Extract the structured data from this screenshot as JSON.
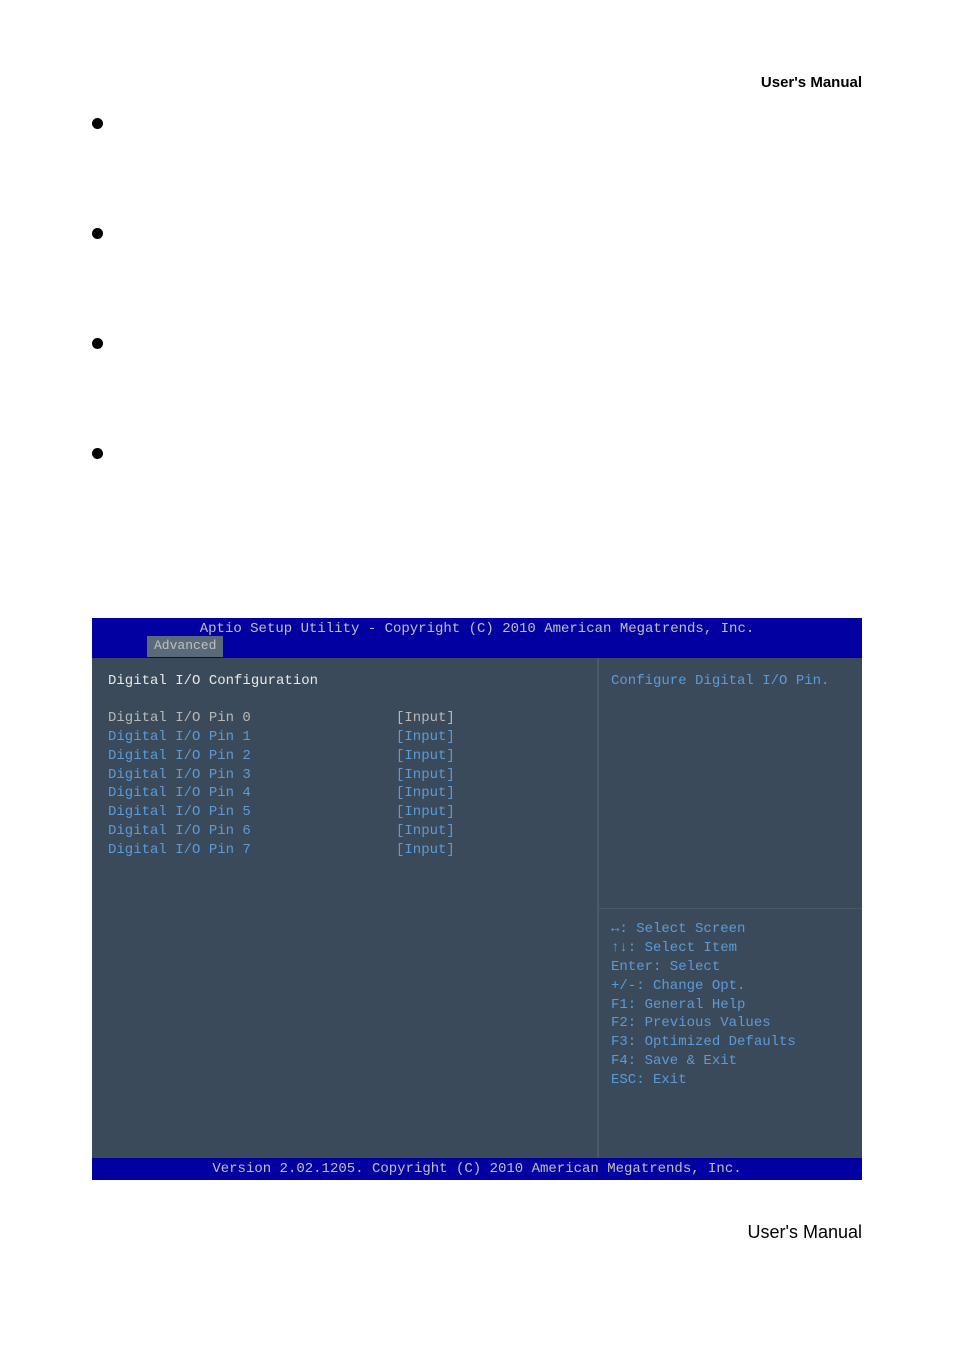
{
  "header": {
    "label": "User's  Manual"
  },
  "footer": {
    "label": "User's  Manual"
  },
  "bios": {
    "title": "Aptio Setup Utility - Copyright (C) 2010 American Megatrends, Inc.",
    "tab": "Advanced",
    "section_head": "Digital I/O Configuration",
    "pins": [
      {
        "label": "Digital I/O Pin 0",
        "value": "[Input]",
        "selected": true
      },
      {
        "label": "Digital I/O Pin 1",
        "value": "[Input]",
        "selected": false
      },
      {
        "label": "Digital I/O Pin 2",
        "value": "[Input]",
        "selected": false
      },
      {
        "label": "Digital I/O Pin 3",
        "value": "[Input]",
        "selected": false
      },
      {
        "label": "Digital I/O Pin 4",
        "value": "[Input]",
        "selected": false
      },
      {
        "label": "Digital I/O Pin 5",
        "value": "[Input]",
        "selected": false
      },
      {
        "label": "Digital I/O Pin 6",
        "value": "[Input]",
        "selected": false
      },
      {
        "label": "Digital I/O Pin 7",
        "value": "[Input]",
        "selected": false
      }
    ],
    "help": "Configure Digital I/O Pin.",
    "nav": {
      "l1": "↔: Select Screen",
      "l2": "↑↓: Select Item",
      "l3": "Enter: Select",
      "l4": "+/-: Change Opt.",
      "l5": "F1: General Help",
      "l6": "F2: Previous Values",
      "l7": "F3: Optimized Defaults",
      "l8": "F4: Save & Exit",
      "l9": "ESC: Exit"
    },
    "bottom": "Version 2.02.1205. Copyright (C) 2010 American Megatrends, Inc."
  }
}
